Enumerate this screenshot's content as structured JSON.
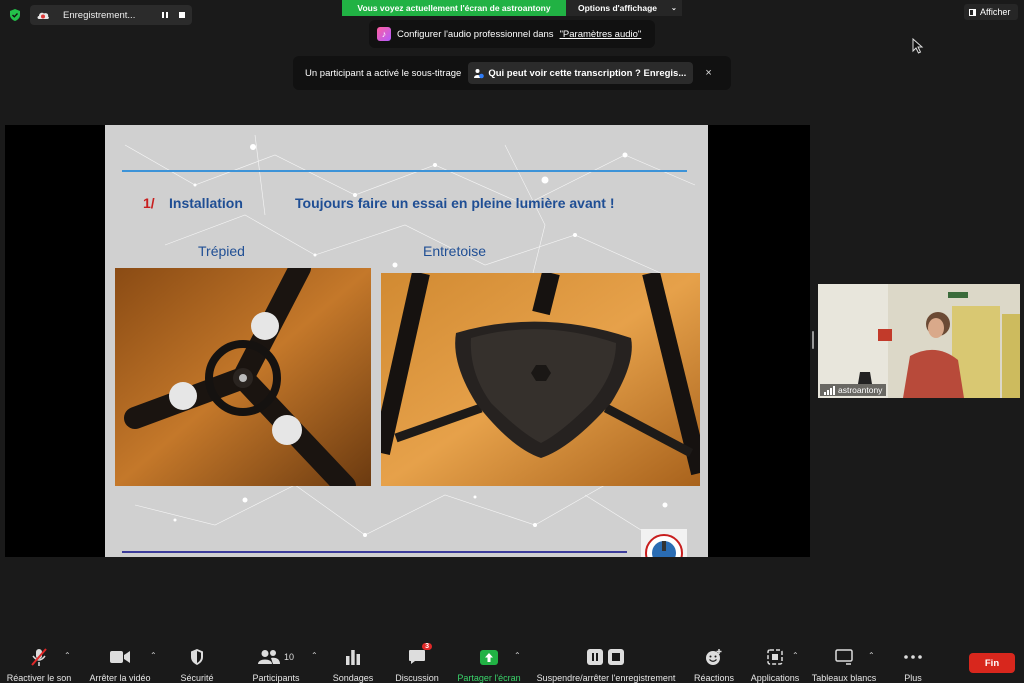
{
  "top": {
    "recording_label": "Enregistrement...",
    "share_banner": "Vous voyez actuellement l'écran de astroantony",
    "view_options": "Options d'affichage",
    "show_button": "Afficher"
  },
  "audio_tip": {
    "text": "Configurer l'audio professionnel dans",
    "link": "\"Paramètres audio\""
  },
  "caption_tip": {
    "text": "Un participant a activé le sous-titrage",
    "button": "Qui peut voir cette transcription ? Enregis...",
    "close": "×"
  },
  "slide": {
    "number": "1/",
    "title": "Installation",
    "subtitle": "Toujours faire un essai en pleine lumière avant !",
    "caption_left": "Trépied",
    "caption_right": "Entretoise"
  },
  "participant": {
    "name": "astroantony"
  },
  "toolbar": {
    "mute": "Réactiver le son",
    "video": "Arrêter la vidéo",
    "security": "Sécurité",
    "participants": "Participants",
    "participants_count": "10",
    "polls": "Sondages",
    "chat": "Discussion",
    "chat_badge": "3",
    "share": "Partager l'écran",
    "record": "Suspendre/arrêter l'enregistrement",
    "reactions": "Réactions",
    "apps": "Applications",
    "whiteboards": "Tableaux blancs",
    "more": "Plus",
    "end": "Fin"
  },
  "colors": {
    "share_green": "#21b244",
    "end_red": "#d8271d",
    "slide_blue": "#1f4e94",
    "slide_red": "#c81e1e"
  }
}
